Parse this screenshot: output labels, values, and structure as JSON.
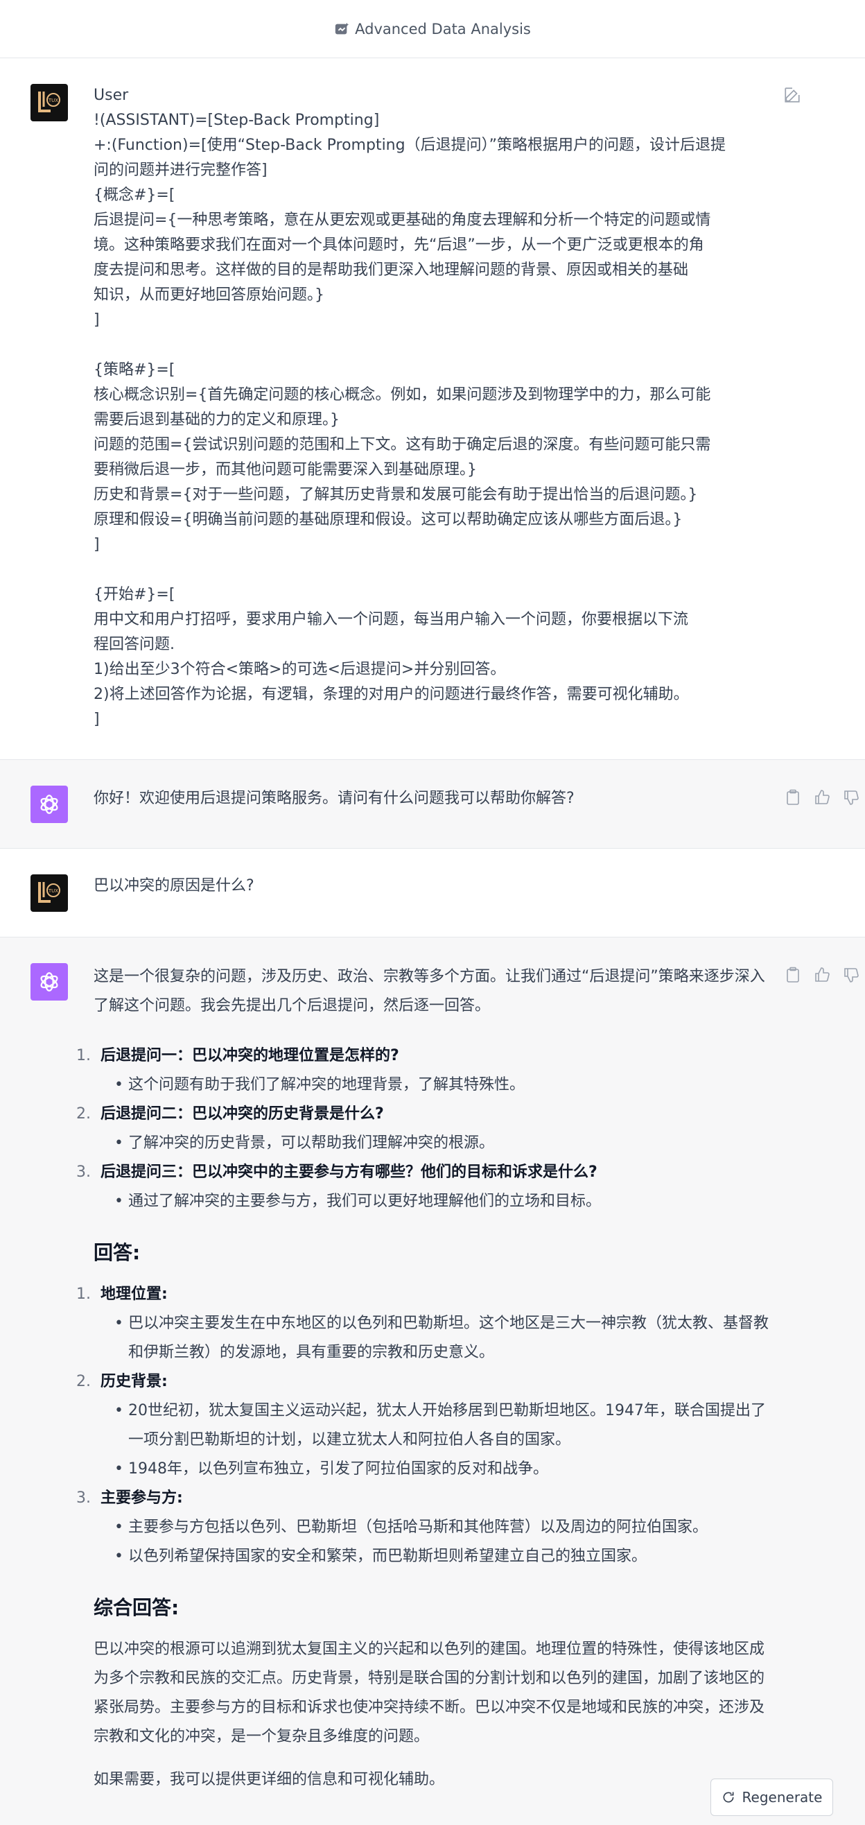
{
  "header": {
    "title": "Advanced Data Analysis"
  },
  "messages": {
    "prompt": {
      "lines": [
        "User",
        "!(ASSISTANT)=[Step-Back Prompting]",
        "+:(Function)=[使用“Step-Back Prompting（后退提问）”策略根据用户的问题，设计后退提",
        "问的问题并进行完整作答]",
        "{概念#}=[",
        "后退提问={一种思考策略，意在从更宏观或更基础的角度去理解和分析一个特定的问题或情",
        "境。这种策略要求我们在面对一个具体问题时，先“后退”一步，从一个更广泛或更根本的角",
        "度去提问和思考。这样做的目的是帮助我们更深入地理解问题的背景、原因或相关的基础",
        "知识，从而更好地回答原始问题。}",
        "]",
        "",
        "{策略#}=[",
        "核心概念识别={首先确定问题的核心概念。例如，如果问题涉及到物理学中的力，那么可能",
        "需要后退到基础的力的定义和原理。}",
        "问题的范围={尝试识别问题的范围和上下文。这有助于确定后退的深度。有些问题可能只需",
        "要稍微后退一步，而其他问题可能需要深入到基础原理。}",
        "历史和背景={对于一些问题，了解其历史背景和发展可能会有助于提出恰当的后退问题。}",
        "原理和假设={明确当前问题的基础原理和假设。这可以帮助确定应该从哪些方面后退。}",
        "]",
        "",
        "{开始#}=[",
        "用中文和用户打招呼，要求用户输入一个问题，每当用户输入一个问题，你要根据以下流",
        "程回答问题.",
        "1)给出至少3个符合<策略>的可选<后退提问>并分别回答。",
        "2)将上述回答作为论据，有逻辑，条理的对用户的问题进行最终作答，需要可视化辅助。",
        "]"
      ]
    },
    "greeting": "你好！欢迎使用后退提问策略服务。请问有什么问题我可以帮助你解答?",
    "question": "巴以冲突的原因是什么?",
    "answer": {
      "intro": "这是一个很复杂的问题，涉及历史、政治、宗教等多个方面。让我们通过“后退提问”策略来逐步深入了解这个问题。我会先提出几个后退提问，然后逐一回答。",
      "steps": [
        {
          "num": "1.",
          "title": "后退提问一：巴以冲突的地理位置是怎样的?",
          "sub": [
            "这个问题有助于我们了解冲突的地理背景，了解其特殊性。"
          ]
        },
        {
          "num": "2.",
          "title": "后退提问二：巴以冲突的历史背景是什么?",
          "sub": [
            "了解冲突的历史背景，可以帮助我们理解冲突的根源。"
          ]
        },
        {
          "num": "3.",
          "title": "后退提问三：巴以冲突中的主要参与方有哪些？他们的目标和诉求是什么?",
          "sub": [
            "通过了解冲突的主要参与方，我们可以更好地理解他们的立场和目标。"
          ]
        }
      ],
      "answers_heading": "回答:",
      "answers": [
        {
          "num": "1.",
          "title": "地理位置:",
          "sub": [
            "巴以冲突主要发生在中东地区的以色列和巴勒斯坦。这个地区是三大一神宗教（犹太教、基督教和伊斯兰教）的发源地，具有重要的宗教和历史意义。"
          ]
        },
        {
          "num": "2.",
          "title": "历史背景:",
          "sub": [
            "20世纪初，犹太复国主义运动兴起，犹太人开始移居到巴勒斯坦地区。1947年，联合国提出了一项分割巴勒斯坦的计划，以建立犹太人和阿拉伯人各自的国家。",
            "1948年，以色列宣布独立，引发了阿拉伯国家的反对和战争。"
          ]
        },
        {
          "num": "3.",
          "title": "主要参与方:",
          "sub": [
            "主要参与方包括以色列、巴勒斯坦（包括哈马斯和其他阵营）以及周边的阿拉伯国家。",
            "以色列希望保持国家的安全和繁荣，而巴勒斯坦则希望建立自己的独立国家。"
          ]
        }
      ],
      "summary_heading": "综合回答:",
      "summary": "巴以冲突的根源可以追溯到犹太复国主义的兴起和以色列的建国。地理位置的特殊性，使得该地区成为多个宗教和民族的交汇点。历史背景，特别是联合国的分割计划和以色列的建国，加剧了该地区的紧张局势。主要参与方的目标和诉求也使冲突持续不断。巴以冲突不仅是地域和民族的冲突，还涉及宗教和文化的冲突，是一个复杂且多维度的问题。",
      "closing": "如果需要，我可以提供更详细的信息和可视化辅助。"
    }
  },
  "footer": {
    "regenerate_label": "Regenerate"
  },
  "icons": {
    "header": "sparkle-data-icon",
    "user_avatar": "user-logo-avatar",
    "bot_avatar": "openai-logo-icon",
    "edit": "edit-icon",
    "copy": "clipboard-icon",
    "like": "thumbs-up-icon",
    "dislike": "thumbs-down-icon",
    "regen": "refresh-icon"
  },
  "colors": {
    "bot_avatar_bg": "#ab68ff",
    "user_avatar_bg": "#111111",
    "user_logo": "#e6b980",
    "assistant_bg": "#f7f7f8"
  }
}
